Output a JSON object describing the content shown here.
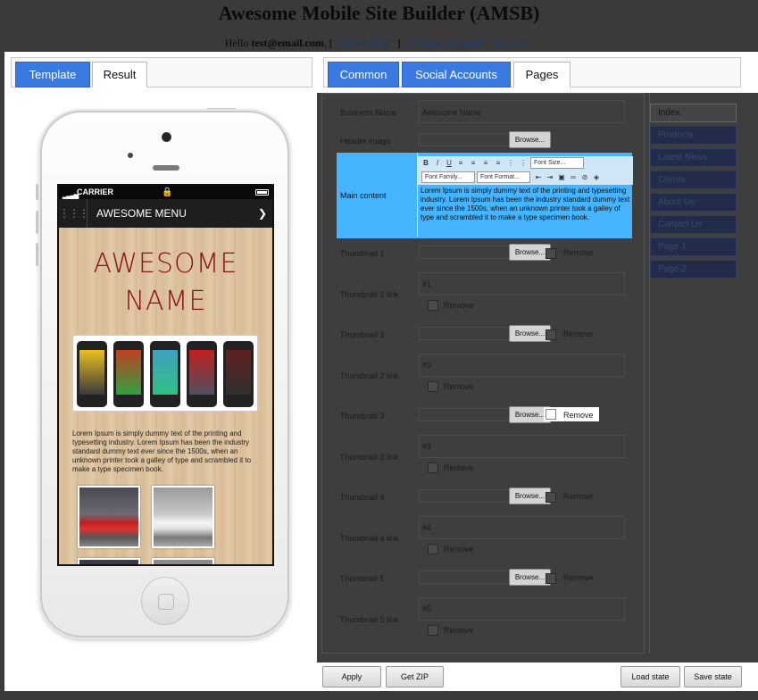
{
  "header": {
    "title": "Awesome Mobile Site Builder (AMSB)",
    "hello_prefix": "Hello",
    "user_email": "test@email.com",
    "bracket_open": ", [",
    "bracket_close": "]",
    "quick_help": "Quick Help",
    "change_password": "Change password",
    "log_out": "Log out"
  },
  "left_tabs": {
    "template": "Template",
    "result": "Result"
  },
  "phone": {
    "carrier": "CARRIER",
    "menu_label": "AWESOME MENU",
    "site_name_line1": "AWESOME",
    "site_name_line2": "NAME",
    "body_text": "Lorem Ipsum is simply dummy text of the printing and typesetting industry. Lorem Ipsum has been the industry standard dummy text ever since the 1500s, when an unknown printer took a galley of type and scrambled it to make a type specimen book."
  },
  "right_tabs": {
    "common": "Common",
    "social": "Social Accounts",
    "pages": "Pages"
  },
  "form": {
    "business_name_label": "Business Name",
    "business_name_value": "Awesome Name",
    "header_image_label": "Header image",
    "browse": "Browse...",
    "main_content_label": "Main content",
    "font_size": "Font Size...",
    "font_family": "Font Family...",
    "font_format": "Font Format...",
    "editor_text": "Lorem Ipsum is simply dummy text of the printing and typesetting industry. Lorem Ipsum has been the industry standard dummy text ever since the 1500s, when an unknown printer took a galley of type and scrambled it to make a type specimen book.",
    "remove": "Remove",
    "thumbnails": [
      {
        "label": "Thumbnail 1",
        "link_label": "Thumbnail 1 link",
        "link_value": "#1"
      },
      {
        "label": "Thumbnail 2",
        "link_label": "Thumbnail 2 link",
        "link_value": "#2"
      },
      {
        "label": "Thumbnail 3",
        "link_label": "Thumbnail 3 link",
        "link_value": "#3"
      },
      {
        "label": "Thumbnail 4",
        "link_label": "Thumbnail 4 link",
        "link_value": "#4"
      },
      {
        "label": "Thumbnail 5",
        "link_label": "Thumbnail 5 link",
        "link_value": "#5"
      }
    ]
  },
  "pages": [
    "Index",
    "Products",
    "Latest News",
    "Clients",
    "About Us",
    "Contact Us",
    "Page 1",
    "Page 2"
  ],
  "buttons": {
    "apply": "Apply",
    "get_zip": "Get ZIP",
    "load_state": "Load state",
    "save_state": "Save state"
  }
}
